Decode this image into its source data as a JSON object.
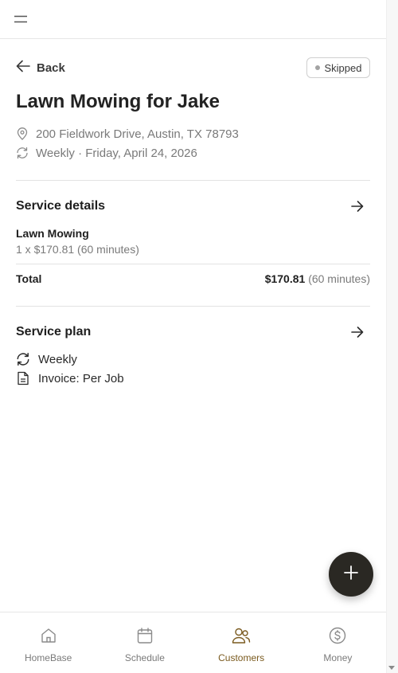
{
  "header": {
    "menu_icon": "hamburger-menu-icon"
  },
  "back": {
    "label": "Back"
  },
  "status": {
    "label": "Skipped",
    "dot_color": "#a3a3a3"
  },
  "job": {
    "title": "Lawn Mowing for Jake",
    "address": "200 Fieldwork Drive, Austin, TX 78793",
    "schedule": "Weekly · Friday, April 24, 2026"
  },
  "service_details": {
    "title": "Service details",
    "items": [
      {
        "name": "Lawn Mowing",
        "detail": "1 x $170.81 (60 minutes)"
      }
    ],
    "total_label": "Total",
    "total_amount": "$170.81",
    "total_duration": "(60 minutes)"
  },
  "service_plan": {
    "title": "Service plan",
    "frequency": "Weekly",
    "invoice": "Invoice: Per Job"
  },
  "fab": {
    "icon": "plus-icon"
  },
  "bottom_nav": {
    "items": [
      {
        "label": "HomeBase",
        "icon": "home-icon",
        "active": false
      },
      {
        "label": "Schedule",
        "icon": "calendar-icon",
        "active": false
      },
      {
        "label": "Customers",
        "icon": "users-icon",
        "active": true
      },
      {
        "label": "Money",
        "icon": "dollar-icon",
        "active": false
      }
    ]
  },
  "colors": {
    "accent": "#7a5a1e",
    "fab_bg": "#2a2823",
    "muted_text": "#7a7a7a"
  }
}
